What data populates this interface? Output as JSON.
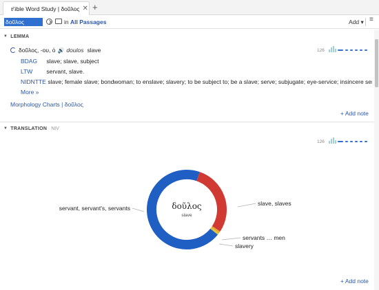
{
  "tab": {
    "title": "Bible Word Study | δοῦλος",
    "close": "✕",
    "add": "+"
  },
  "toolbar": {
    "search_value": "δοῦλος",
    "in_label": "in",
    "passages": "All Passages",
    "add_label": "Add ▾",
    "menu_icon": "≡"
  },
  "lemma": {
    "header": "LEMMA",
    "word": "δοῦλος, -ου, ὁ",
    "translit": "doulos",
    "gloss": "slave",
    "count": "126",
    "definitions": [
      {
        "source": "BDAG",
        "text": "slave; slave, subject"
      },
      {
        "source": "LTW",
        "text": "servant, slave."
      },
      {
        "source": "NIDNTTE",
        "text": "slave; female slave; bondwoman; to enslave; slavery; to be subject to; be a slave; serve; subjugate; eye-service; insincere servi…"
      }
    ],
    "more": "More »",
    "morph": "Morphology Charts  |  δοῦλος",
    "add_note": "+ Add note"
  },
  "translation": {
    "header": "TRANSLATION",
    "version": "NIV",
    "count": "126",
    "add_note": "+ Add note"
  },
  "chart_data": {
    "type": "pie",
    "center_title": "δοῦλος",
    "center_subtitle": "slave",
    "slices": [
      {
        "label": "slave, slaves",
        "value": 0.29,
        "color": "#d03a32"
      },
      {
        "label": "servants … men",
        "value": 0.008,
        "color": "#e7a533"
      },
      {
        "label": "slavery",
        "value": 0.008,
        "color": "#e1c33a"
      },
      {
        "label": "servant, servant's, servants",
        "value": 0.694,
        "color": "#1f5ec3"
      }
    ]
  }
}
